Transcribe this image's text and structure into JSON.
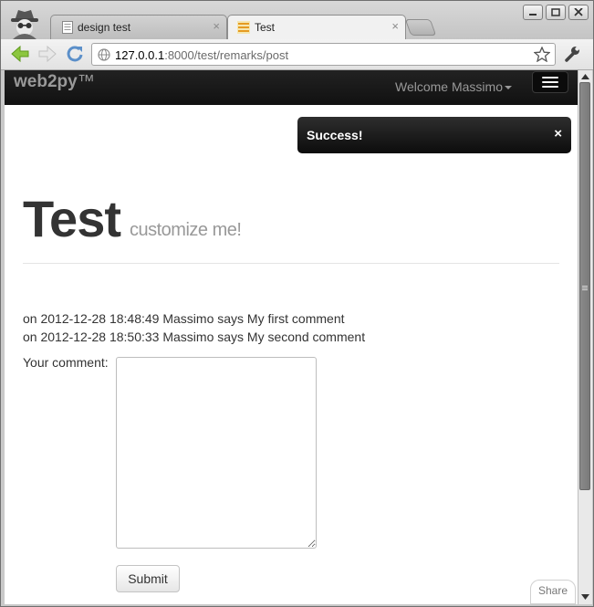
{
  "browser": {
    "tabs": [
      {
        "label": "design test",
        "close": "×",
        "active": false
      },
      {
        "label": "Test",
        "close": "×",
        "active": true
      }
    ],
    "address": {
      "host": "127.0.0.1",
      "path": ":8000/test/remarks/post"
    }
  },
  "page": {
    "navbar": {
      "brand_name": "web2py",
      "brand_tm": "™",
      "welcome": "Welcome Massimo"
    },
    "flash": {
      "message": "Success!",
      "close": "×"
    },
    "header": {
      "title": "Test",
      "subtitle": "customize me!"
    },
    "comments": [
      {
        "text": "on 2012-12-28 18:48:49 Massimo says My first comment"
      },
      {
        "text": "on 2012-12-28 18:50:33 Massimo says My second comment"
      }
    ],
    "form": {
      "label": "Your comment:",
      "value": "",
      "submit_label": "Submit"
    },
    "share_label": "Share"
  },
  "colors": {
    "navbar": "#1b1b1b",
    "flash": "#1a1a1a",
    "title": "#333333",
    "subtitle": "#999999"
  }
}
